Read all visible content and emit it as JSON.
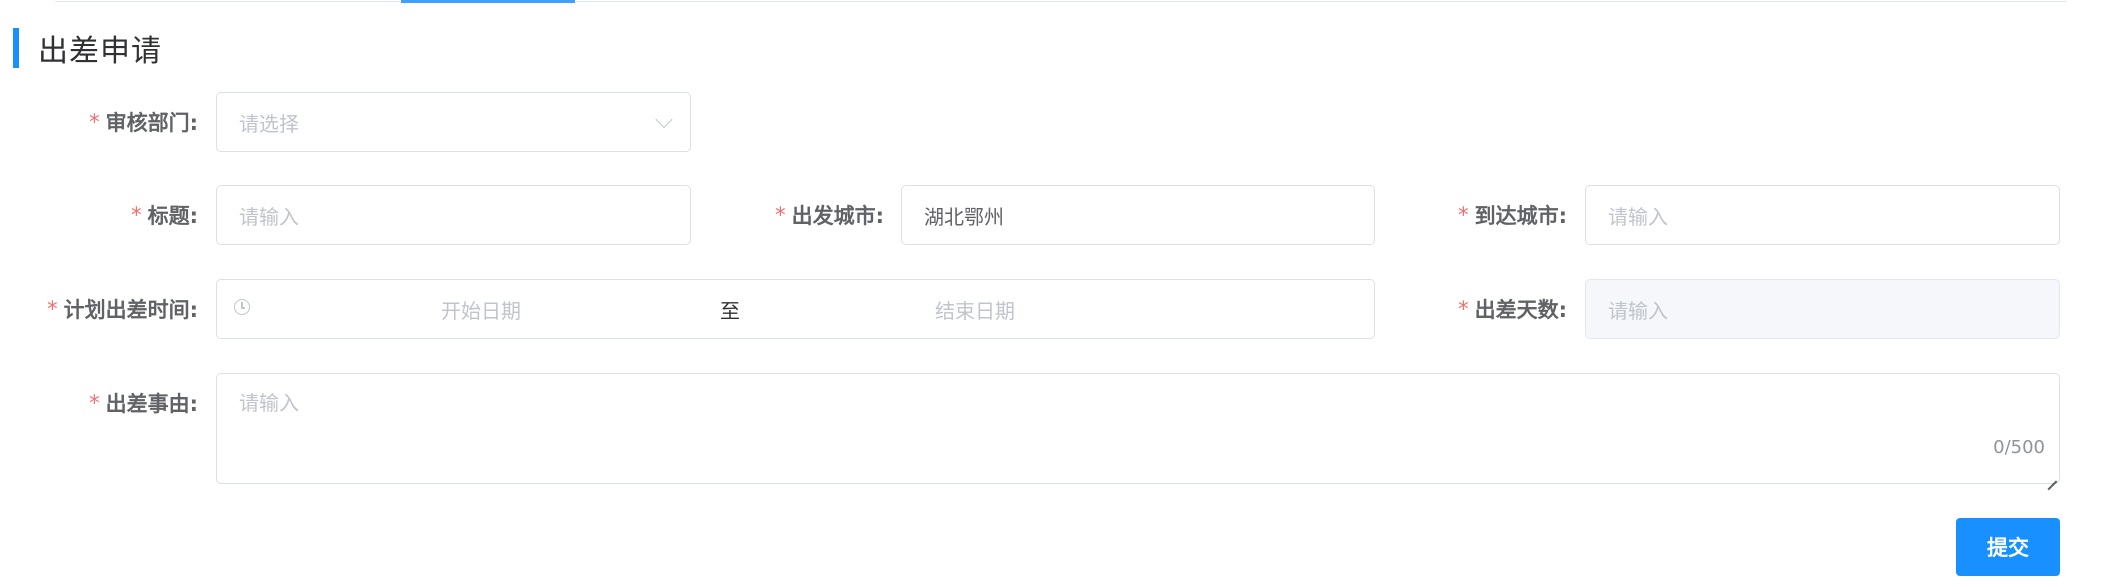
{
  "section": {
    "title": "出差申请"
  },
  "form": {
    "department": {
      "label": "审核部门:",
      "placeholder": "请选择"
    },
    "title": {
      "label": "标题:",
      "placeholder": "请输入"
    },
    "departure_city": {
      "label": "出发城市:",
      "value": "湖北鄂州"
    },
    "arrival_city": {
      "label": "到达城市:",
      "placeholder": "请输入"
    },
    "planned_time": {
      "label": "计划出差时间:",
      "start_placeholder": "开始日期",
      "separator": "至",
      "end_placeholder": "结束日期"
    },
    "trip_days": {
      "label": "出差天数:",
      "placeholder": "请输入"
    },
    "reason": {
      "label": "出差事由:",
      "placeholder": "请输入",
      "count": "0/500"
    },
    "required_mark": "*"
  },
  "actions": {
    "submit_label": "提交"
  },
  "colors": {
    "accent": "#1890ff",
    "required": "#f56c6c",
    "tab_active": "#409eff"
  },
  "icons": {
    "select_arrow": "chevron-down-icon",
    "date_range": "clock-icon"
  }
}
